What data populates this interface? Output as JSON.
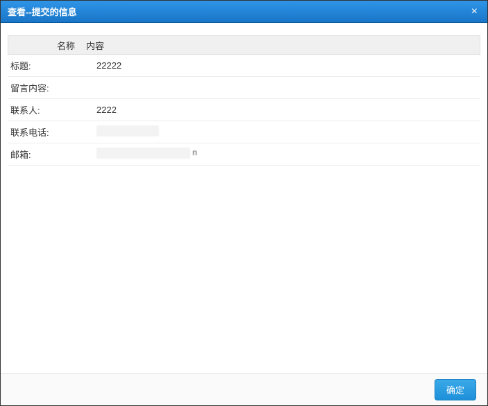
{
  "dialog": {
    "title": "查看--提交的信息",
    "close": "×"
  },
  "table": {
    "headers": {
      "name": "名称",
      "content": "内容"
    },
    "rows": [
      {
        "label": "标题:",
        "value": "22222",
        "redacted": false
      },
      {
        "label": "留言内容:",
        "value": "",
        "redacted": false
      },
      {
        "label": "联系人:",
        "value": "2222",
        "redacted": false
      },
      {
        "label": "联系电话:",
        "value": "",
        "redacted": true,
        "trail": ""
      },
      {
        "label": "邮箱:",
        "value": "",
        "redacted": true,
        "trail": "n"
      }
    ]
  },
  "footer": {
    "ok": "确定"
  }
}
